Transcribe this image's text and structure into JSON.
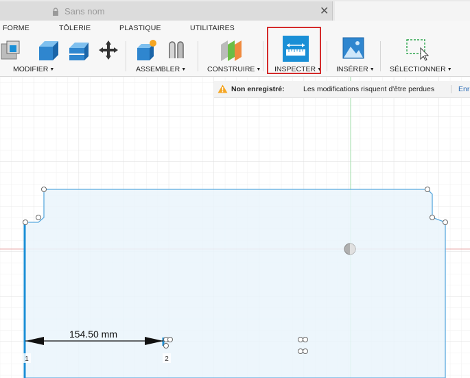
{
  "tab": {
    "title": "Sans nom",
    "close_glyph": "✕"
  },
  "toolbar": {
    "tabs": [
      "FORME",
      "TÔLERIE",
      "PLASTIQUE",
      "UTILITAIRES"
    ],
    "groups": {
      "modifier": "MODIFIER",
      "assembler": "ASSEMBLER",
      "construire": "CONSTRUIRE",
      "inspecter": "INSPECTER",
      "inserer": "INSÉRER",
      "selectionner": "SÉLECTIONNER"
    }
  },
  "notice": {
    "title": "Non enregistré:",
    "message": "Les modifications risquent d'être perdues",
    "link": "Enr"
  },
  "sketch": {
    "dimension": "154.50 mm",
    "point_labels": [
      "1",
      "2"
    ]
  },
  "colors": {
    "accent": "#1a8fd6",
    "highlight": "#d42b2b",
    "sketch_fill": "#eaf4fb",
    "sketch_line": "#5aa9de"
  }
}
